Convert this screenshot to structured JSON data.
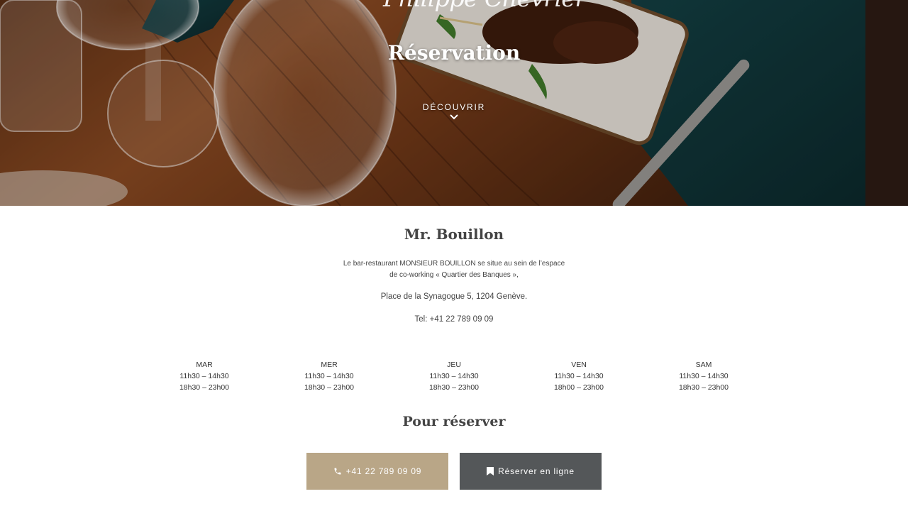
{
  "hero": {
    "signature": "Philippe Chevrier",
    "title": "Réservation",
    "discover_label": "DÉCOUVRIR"
  },
  "restaurant": {
    "name": "Mr. Bouillon",
    "intro_line1": "Le bar-restaurant MONSIEUR BOUILLON se situe au sein de l’espace",
    "intro_line2": "de co-working « Quartier des Banques »,",
    "address": "Place de la Synagogue 5,  1204 Genève.",
    "tel": "Tel: +41  22 789 09 09"
  },
  "hours": [
    {
      "day": "MAR",
      "lunch": "11h30 – 14h30",
      "dinner": "18h30 – 23h00"
    },
    {
      "day": "MER",
      "lunch": "11h30 – 14h30",
      "dinner": "18h30 – 23h00"
    },
    {
      "day": "JEU",
      "lunch": "11h30 – 14h30",
      "dinner": "18h30 – 23h00"
    },
    {
      "day": "VEN",
      "lunch": "11h30 – 14h30",
      "dinner": "18h00 – 23h00"
    },
    {
      "day": "SAM",
      "lunch": "11h30 – 14h30",
      "dinner": "18h30 – 23h00"
    }
  ],
  "reserve": {
    "title": "Pour réserver",
    "phone_button": "+41  22  789 09 09",
    "online_button": "Réserver en ligne"
  },
  "colors": {
    "phone_button_bg": "#b9a687",
    "online_button_bg": "#545759"
  },
  "icons": {
    "phone": "phone-icon",
    "bookmark": "bookmark-icon",
    "chevron": "chevron-down-icon"
  }
}
